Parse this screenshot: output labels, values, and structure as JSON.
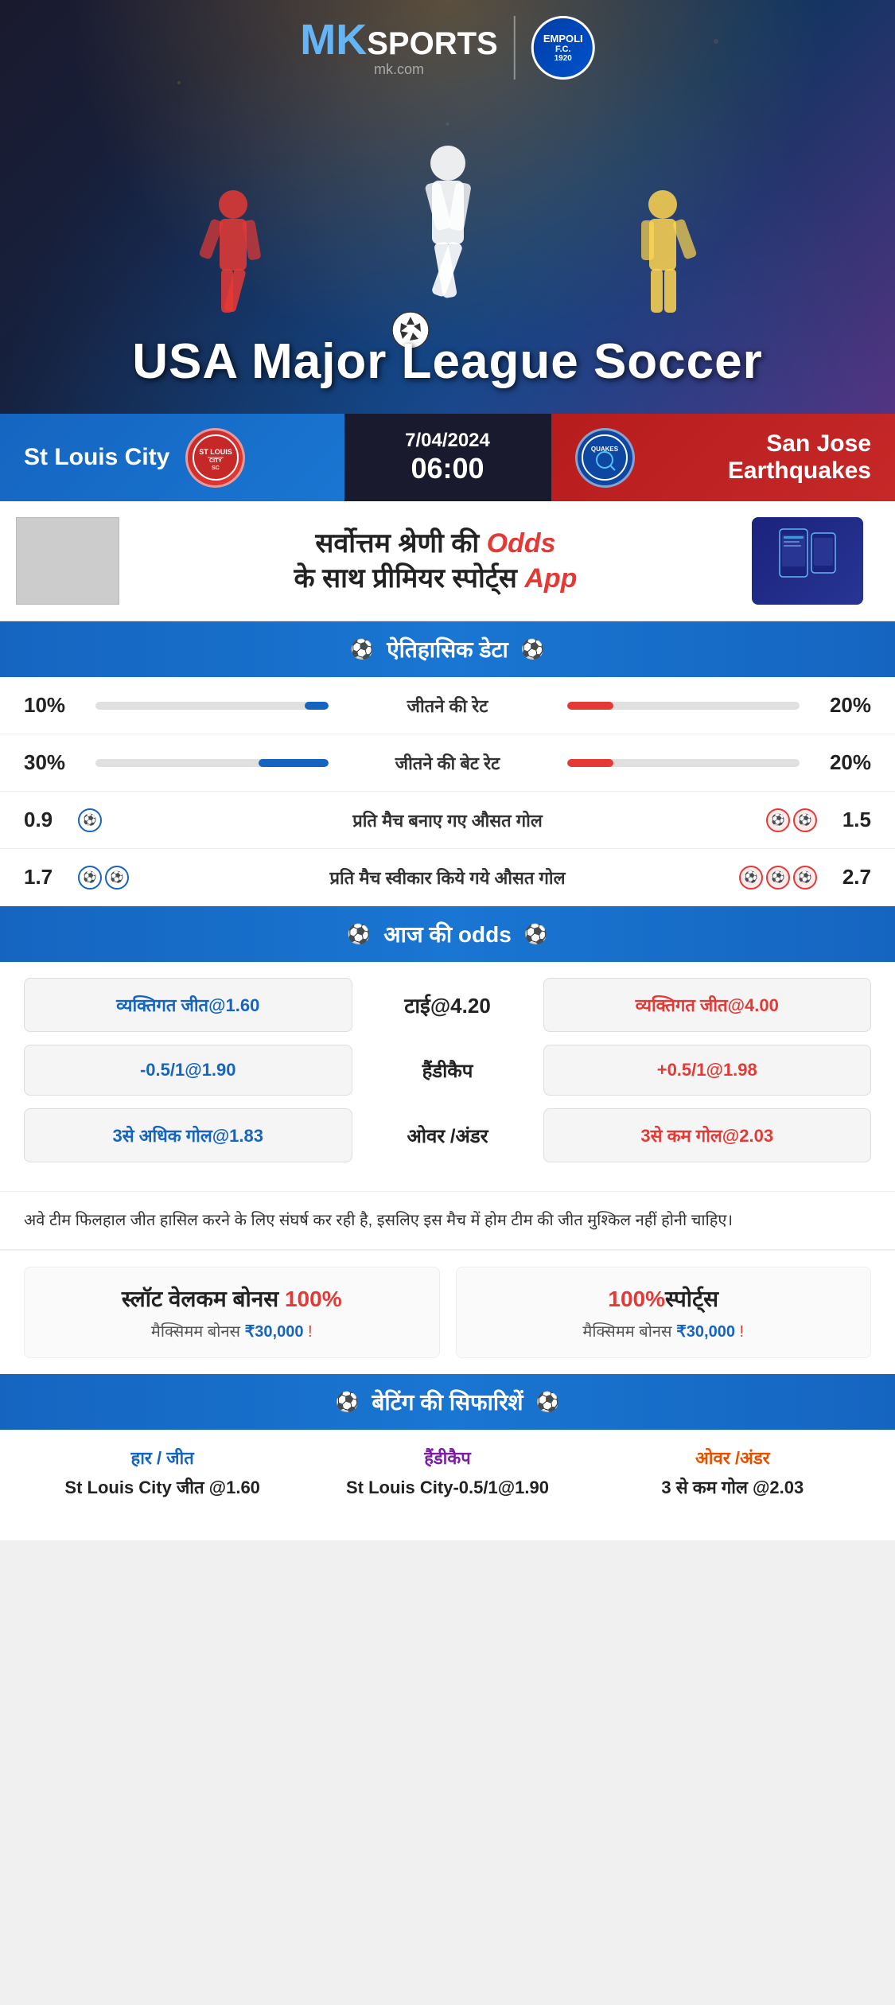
{
  "hero": {
    "title": "USA Major League Soccer",
    "logo_mk": "MK",
    "logo_sports": "SPORTS",
    "logo_sub": "mk.com",
    "empoli_text": "EMPOLI F.C.\n1920"
  },
  "match": {
    "home_team": "St Louis City",
    "away_team": "San Jose Earthquakes",
    "date": "7/04/2024",
    "time": "06:00",
    "home_logo": "CITY SC",
    "away_logo": "QUAKES"
  },
  "ad": {
    "main_text": "सर्वोत्तम श्रेणी की Odds के साथ प्रीमियर स्पोर्ट्स App",
    "highlight": "Odds"
  },
  "historical": {
    "section_title": "ऐतिहासिक डेटा",
    "rows": [
      {
        "label": "जीतने की रेट",
        "left_val": "10%",
        "right_val": "20%",
        "left_pct": 10,
        "right_pct": 20
      },
      {
        "label": "जीतने की बेट रेट",
        "left_val": "30%",
        "right_val": "20%",
        "left_pct": 30,
        "right_pct": 20
      }
    ],
    "goal_rows": [
      {
        "label": "प्रति मैच बनाए गए औसत गोल",
        "left_val": "0.9",
        "right_val": "1.5",
        "left_balls": 1,
        "right_balls": 2
      },
      {
        "label": "प्रति मैच स्वीकार किये गये औसत गोल",
        "left_val": "1.7",
        "right_val": "2.7",
        "left_balls": 2,
        "right_balls": 3
      }
    ]
  },
  "odds": {
    "section_title": "आज की odds",
    "rows": [
      {
        "left_label": "व्यक्तिगत जीत@1.60",
        "center_label": "टाई@4.20",
        "right_label": "व्यक्तिगत जीत@4.00",
        "left_color": "blue",
        "right_color": "red"
      },
      {
        "left_label": "-0.5/1@1.90",
        "center_label": "हैंडीकैप",
        "right_label": "+0.5/1@1.98",
        "left_color": "blue",
        "right_color": "red"
      },
      {
        "left_label": "3से अधिक गोल@1.83",
        "center_label": "ओवर /अंडर",
        "right_label": "3से कम गोल@2.03",
        "left_color": "blue",
        "right_color": "red"
      }
    ]
  },
  "description": "अवे टीम फिलहाल जीत हासिल करने के लिए संघर्ष कर रही है, इसलिए इस मैच में होम टीम की जीत मुश्किल नहीं होनी चाहिए।",
  "bonus": {
    "card1": {
      "title": "स्लॉट वेलकम बोनस 100%",
      "sub": "मैक्सिमम बोनस ₹30,000  !"
    },
    "card2": {
      "title": "100%स्पोर्ट्स",
      "sub": "मैक्सिमम बोनस  ₹30,000 !"
    }
  },
  "recommendations": {
    "section_title": "बेटिंग की सिफारिशें",
    "cols": [
      {
        "label": "हार / जीत",
        "label_color": "blue",
        "value": "St Louis City जीत @1.60"
      },
      {
        "label": "हैंडीकैप",
        "label_color": "purple",
        "value": "St Louis City-0.5/1@1.90"
      },
      {
        "label": "ओवर /अंडर",
        "label_color": "orange",
        "value": "3 से कम गोल @2.03"
      }
    ]
  }
}
